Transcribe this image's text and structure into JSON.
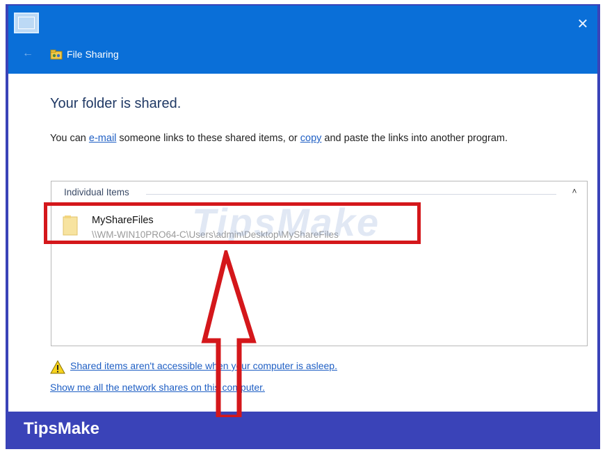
{
  "window": {
    "title": "File Sharing",
    "close_glyph": "✕",
    "back_glyph": "←"
  },
  "content": {
    "heading": "Your folder is shared.",
    "desc_prefix": "You can ",
    "email_link": "e-mail",
    "desc_middle": " someone links to these shared items, or ",
    "copy_link": "copy",
    "desc_suffix": " and paste the links into another program."
  },
  "items_group": {
    "header": "Individual Items",
    "caret": "˄",
    "items": [
      {
        "name": "MyShareFiles",
        "path": "\\\\WM-WIN10PRO64-C\\Users\\admin\\Desktop\\MyShareFiles"
      }
    ]
  },
  "footer_links": {
    "asleep_warning": "Shared items aren't accessible when your computer is asleep.",
    "network_shares": "Show me all the network shares on this computer."
  },
  "watermark": "TipsMake",
  "brand": "TipsMake",
  "colors": {
    "titlebar": "#0a6fd8",
    "brand_frame": "#3a43b8",
    "highlight": "#d4171b",
    "link": "#1f5fc4"
  },
  "icons": {
    "app": "window-icon",
    "back": "back-arrow-icon",
    "share": "file-sharing-icon",
    "close": "close-icon",
    "folder": "folder-icon",
    "warning": "warning-icon",
    "caret": "chevron-up-icon"
  }
}
